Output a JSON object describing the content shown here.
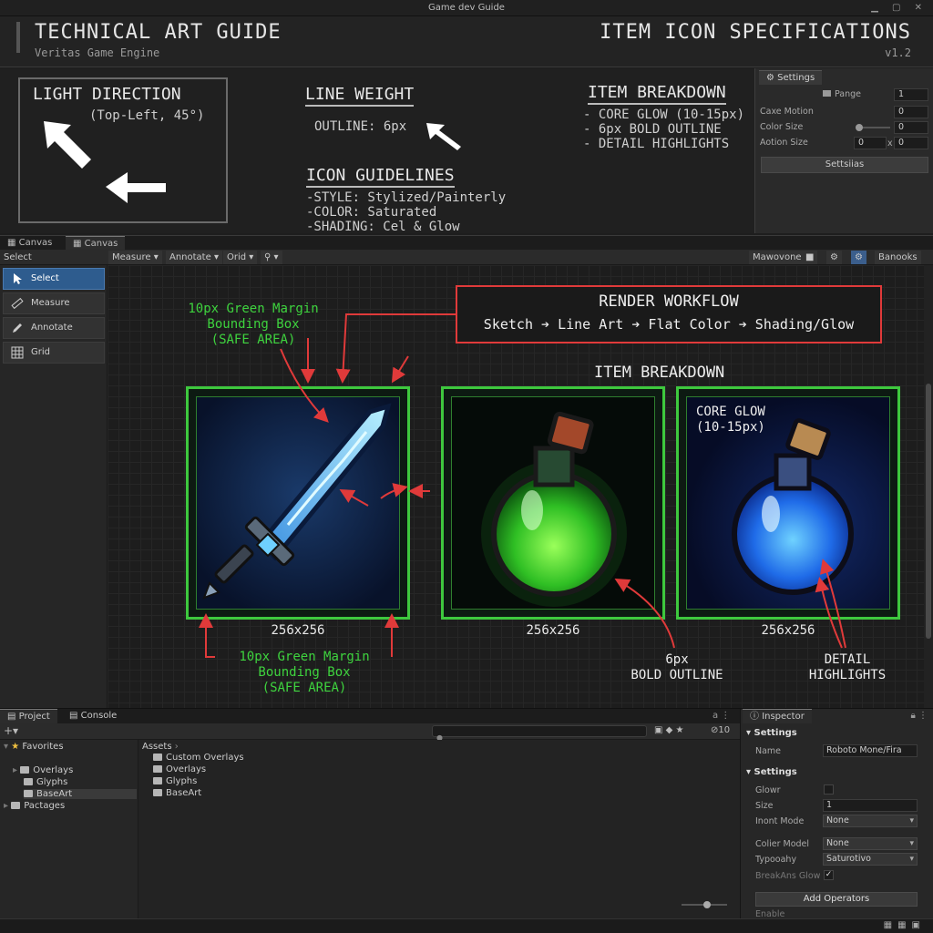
{
  "window": {
    "title": "Game dev Guide"
  },
  "header": {
    "title_left": "TECHNICAL ART GUIDE",
    "subtitle_left": "Veritas Game Engine",
    "title_right": "ITEM ICON SPECIFICATIONS",
    "version": "v1.2"
  },
  "spec": {
    "light": {
      "title": "LIGHT DIRECTION",
      "subtitle": "(Top-Left, 45°)"
    },
    "line_weight": {
      "title": "LINE WEIGHT",
      "outline": "OUTLINE: 6px"
    },
    "guidelines": {
      "title": "ICON GUIDELINES",
      "lines": [
        "-STYLE: Stylized/Painterly",
        "-COLOR: Saturated",
        "-SHADING: Cel & Glow"
      ]
    },
    "breakdown": {
      "title": "ITEM BREAKDOWN",
      "lines": [
        "- CORE GLOW (10-15px)",
        "- 6px BOLD OUTLINE",
        "- DETAIL HIGHLIGHTS"
      ]
    }
  },
  "settings_panel": {
    "tab": "Settings",
    "page_label": "Pange",
    "page_value": "1",
    "cake_motion_label": "Caxe Motion",
    "cake_motion_value": "0",
    "color_size_label": "Color Size",
    "color_size_value": "0",
    "action_size_label": "Aotion Size",
    "action_size_x": "0",
    "action_size_sep": "x",
    "action_size_y": "0",
    "button": "Settsiias"
  },
  "canvas_tabs": [
    "Canvas",
    "Canvas"
  ],
  "toolbar": {
    "left_label": "Select",
    "measure": "Measure",
    "annotate": "Annotate",
    "grid": "Orid",
    "right1": "Mawovone",
    "right2": "Banooks"
  },
  "tools": [
    "Select",
    "Measure",
    "Annotate",
    "Grid"
  ],
  "canvas": {
    "workflow": {
      "title": "RENDER WORKFLOW",
      "steps": "Sketch ➔ Line Art ➔ Flat Color ➔ Shading/Glow"
    },
    "item_breakdown_title": "ITEM BREAKDOWN",
    "margin_note_top": "10px Green Margin\nBounding Box\n(SAFE AREA)",
    "margin_note_bottom": "10px Green Margin\nBounding Box\n(SAFE AREA)",
    "px_note": "6px",
    "core_glow_note": "CORE GLOW\n(10-15px)",
    "bold_outline_note": "6px\nBOLD OUTLINE",
    "detail_note": "DETAIL\nHIGHLIGHTS",
    "icons": [
      {
        "name": "sword",
        "size": "256x256"
      },
      {
        "name": "green-potion",
        "size": "256x256"
      },
      {
        "name": "blue-potion",
        "size": "256x256"
      }
    ],
    "colors": {
      "margin": "#3ec83e",
      "annotation": "#e03a3a"
    }
  },
  "project": {
    "tabs": [
      "Project",
      "Console"
    ],
    "hidden_count": "10",
    "tree": {
      "favorites": "Favorites",
      "items": [
        "Overlays",
        "Glyphs",
        "BaseArt"
      ],
      "packages": "Pactages"
    },
    "assets_label": "Assets",
    "assets": [
      "Custom Overlays",
      "Overlays",
      "Glyphs",
      "BaseArt"
    ]
  },
  "inspector": {
    "tab": "Inspector",
    "section1": "Settings",
    "name_label": "Name",
    "name_value": "Roboto Mone/Fira",
    "section2": "Settings",
    "glow_label": "Glowr",
    "size_label": "Size",
    "size_value": "1",
    "input_mode_label": "Inont Mode",
    "input_mode_value": "None",
    "color_model_label": "Colier Model",
    "color_model_value": "None",
    "typography_label": "Typooahy",
    "typography_value": "Saturotivo",
    "break_glow_label": "BreakAns Glow",
    "add_button": "Add Operators",
    "enable_label": "Enable"
  }
}
